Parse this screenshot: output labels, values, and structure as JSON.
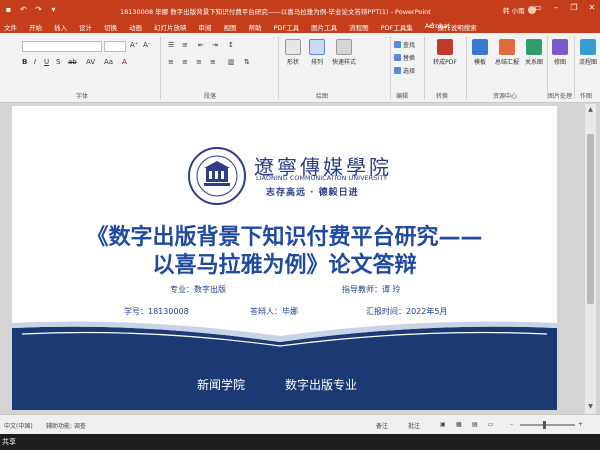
{
  "titlebar": {
    "doc_title": "18130008 毕娜 数字出版背景下知识付费平台研究——以喜马拉雅为例-毕业论文答辩PPT(1) - PowerPoint",
    "user_name": "韩 小雨",
    "qat_icons": [
      "save-icon",
      "undo-icon",
      "redo-icon",
      "customize-icon"
    ],
    "window_buttons": [
      "minimize-icon",
      "restore-icon",
      "close-icon"
    ],
    "accent_color": "#c43e1c"
  },
  "tabs": [
    {
      "label": "文件"
    },
    {
      "label": "开始"
    },
    {
      "label": "插入"
    },
    {
      "label": "设计"
    },
    {
      "label": "切换"
    },
    {
      "label": "动画"
    },
    {
      "label": "幻灯片放映"
    },
    {
      "label": "审阅"
    },
    {
      "label": "视图"
    },
    {
      "label": "帮助"
    },
    {
      "label": "PDF工具"
    },
    {
      "label": "图片工具"
    },
    {
      "label": "流程图"
    },
    {
      "label": "PDF工具集"
    },
    {
      "label": "Acrobat"
    }
  ],
  "tell_me": "操作说明搜索",
  "ribbon": {
    "group_labels": {
      "font": "字体",
      "paragraph": "段落",
      "drawing": "绘图",
      "editing": "编辑",
      "convert": "转换",
      "resource": "资源中心",
      "picture": "图片处理",
      "create": "作图"
    },
    "drawing_items": [
      {
        "label": "形状"
      },
      {
        "label": "排列"
      },
      {
        "label": "快速样式"
      }
    ],
    "editing_items": [
      {
        "label": "查找"
      },
      {
        "label": "替换"
      },
      {
        "label": "选择"
      }
    ],
    "convert_item": {
      "label": "转成PDF"
    },
    "resource_items": [
      {
        "label": "模板"
      },
      {
        "label": "总结汇报"
      },
      {
        "label": "关系图"
      }
    ],
    "picture_item": {
      "label": "修图"
    },
    "create_item": {
      "label": "流程图"
    }
  },
  "slide": {
    "logo": {
      "cn": "遼寧傳媒學院",
      "en": "LIAONING COMMUNICATION UNIVERSITY",
      "motto": "志存高远 · 德毅日进"
    },
    "title_line1": "《数字出版背景下知识付费平台研究——",
    "title_line2": "以喜马拉雅为例》论文答辩",
    "major": "专业：数字出版",
    "advisor": "指导教师：谭 玲",
    "student_id": "学号：18130008",
    "defender": "答辩人：毕娜",
    "report_time": "汇报时间：2022年5月",
    "footer_school": "新闻学院",
    "footer_major": "数字出版专业",
    "navy_color": "#1b3a73"
  },
  "statusbar": {
    "language": "中文(中国)",
    "accessibility": "辅助功能: 调查",
    "notes": "备注",
    "comments": "批注"
  },
  "bottom_text": "共享"
}
